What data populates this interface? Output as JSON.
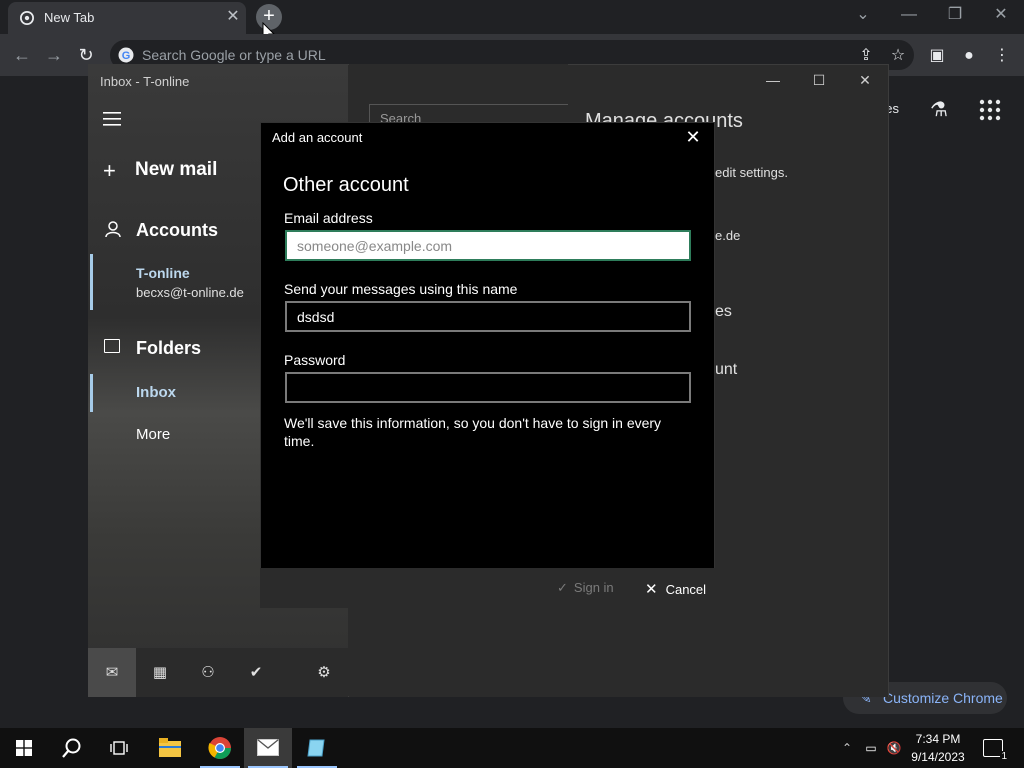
{
  "chrome": {
    "tab_title": "New Tab",
    "omnibox_placeholder": "Search Google or type a URL",
    "images_link": "ges",
    "customize_label": "Customize Chrome"
  },
  "mail": {
    "window_title": "Inbox - T-online",
    "new_mail": "New mail",
    "accounts": "Accounts",
    "account_name": "T-online",
    "account_email": "becxs@t-online.de",
    "folders": "Folders",
    "inbox": "Inbox",
    "more": "More",
    "search_placeholder": "Search",
    "manage_title": "Manage accounts",
    "manage_line1": "edit settings.",
    "manage_line2": "e.de",
    "manage_line3": "es",
    "manage_line4": "unt"
  },
  "dialog": {
    "title": "Add an account",
    "heading": "Other account",
    "email_label": "Email address",
    "email_placeholder": "someone@example.com",
    "name_label": "Send your messages using this name",
    "name_value": "dsdsd",
    "password_label": "Password",
    "info": "We'll save this information, so you don't have to sign in every time.",
    "signin": "Sign in",
    "cancel": "Cancel"
  },
  "taskbar": {
    "time": "7:34 PM",
    "date": "9/14/2023",
    "notification_count": "1"
  },
  "colors": {
    "accent": "#a6cbe8",
    "email_focus": "#2e7d5b",
    "chrome_link": "#8ab4f8"
  }
}
